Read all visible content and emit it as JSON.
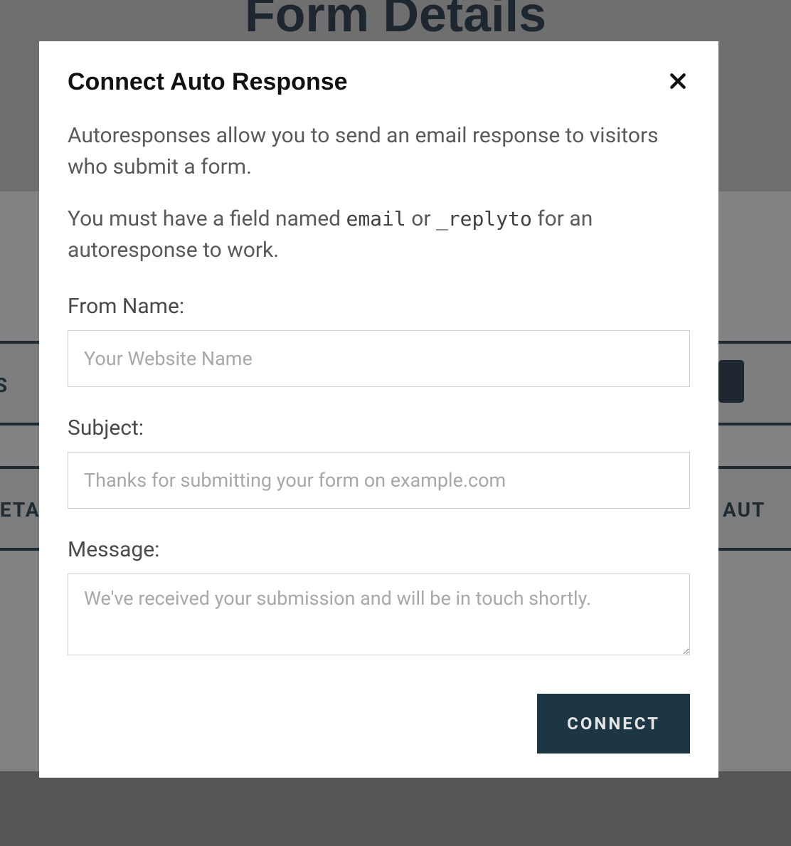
{
  "background": {
    "page_title": "Form Details",
    "label_ns": "ns",
    "label_eets": "EETS",
    "label_beta": "BETA",
    "label_aut": "AUT"
  },
  "modal": {
    "title": "Connect Auto Response",
    "description1": "Autoresponses allow you to send an email response to visitors who submit a form.",
    "description2_pre": "You must have a field named ",
    "description2_code1": "email",
    "description2_mid": " or ",
    "description2_code2": "_replyto",
    "description2_post": " for an autoresponse to work.",
    "fields": {
      "from_name": {
        "label": "From Name:",
        "placeholder": "Your Website Name",
        "value": ""
      },
      "subject": {
        "label": "Subject:",
        "placeholder": "Thanks for submitting your form on example.com",
        "value": ""
      },
      "message": {
        "label": "Message:",
        "placeholder": "We've received your submission and will be in touch shortly.",
        "value": ""
      }
    },
    "connect_button": "CONNECT"
  }
}
